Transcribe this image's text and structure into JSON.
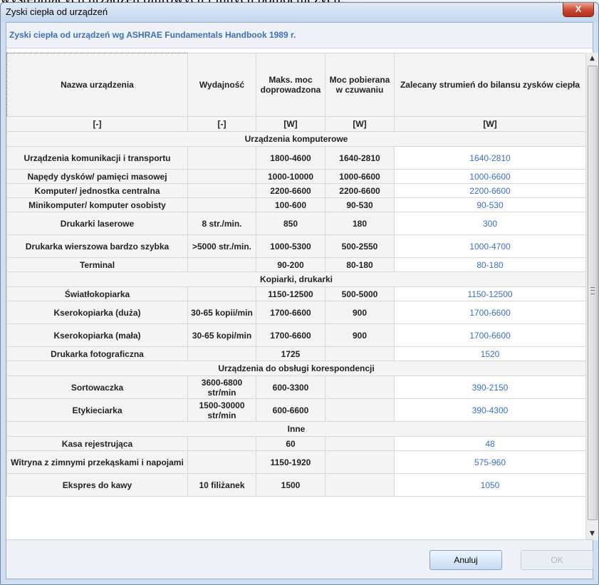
{
  "background_text": "występujących urządzeń biurowych i innych pomocniczych.",
  "window": {
    "title": "Zyski ciepła od urządzeń",
    "close_label": "X"
  },
  "panel_title": "Zyski ciepła od urządzeń wg ASHRAE Fundamentals Handbook 1989 r.",
  "columns": [
    {
      "header": "Nazwa urządzenia",
      "unit": "[-]"
    },
    {
      "header": "Wydajność",
      "unit": "[-]"
    },
    {
      "header": "Maks. moc doprowadzona",
      "unit": "[W]"
    },
    {
      "header": "Moc pobierana w czuwaniu",
      "unit": "[W]"
    },
    {
      "header": "Zalecany strumień do bilansu zysków ciepła",
      "unit": "[W]"
    }
  ],
  "groups": [
    {
      "label": "Urządzenia komputerowe",
      "rows": [
        [
          "Urządzenia komunikacji i transportu",
          "",
          "1800-4600",
          "1640-2810",
          "1640-2810"
        ],
        [
          "Napędy dysków/ pamięci masowej",
          "",
          "1000-10000",
          "1000-6600",
          "1000-6600"
        ],
        [
          "Komputer/ jednostka centralna",
          "",
          "2200-6600",
          "2200-6600",
          "2200-6600"
        ],
        [
          "Minikomputer/ komputer osobisty",
          "",
          "100-600",
          "90-530",
          "90-530"
        ],
        [
          "Drukarki laserowe",
          "8 str./min.",
          "850",
          "180",
          "300"
        ],
        [
          "Drukarka wierszowa bardzo szybka",
          ">5000 str./min.",
          "1000-5300",
          "500-2550",
          "1000-4700"
        ],
        [
          "Terminal",
          "",
          "90-200",
          "80-180",
          "80-180"
        ]
      ]
    },
    {
      "label": "Kopiarki, drukarki",
      "rows": [
        [
          "Światłokopiarka",
          "",
          "1150-12500",
          "500-5000",
          "1150-12500"
        ],
        [
          "Kserokopiarka (duża)",
          "30-65 kopii/min",
          "1700-6600",
          "900",
          "1700-6600"
        ],
        [
          "Kserokopiarka (mała)",
          "30-65 kopi/min",
          "1700-6600",
          "900",
          "1700-6600"
        ],
        [
          "Drukarka fotograficzna",
          "",
          "1725",
          "",
          "1520"
        ]
      ]
    },
    {
      "label": "Urządzenia do obsługi korespondencji",
      "rows": [
        [
          "Sortowaczka",
          "3600-6800 str/min",
          "600-3300",
          "",
          "390-2150"
        ],
        [
          "Etykieciarka",
          "1500-30000 str/min",
          "600-6600",
          "",
          "390-4300"
        ]
      ]
    },
    {
      "label": "Inne",
      "rows": [
        [
          "Kasa rejestrująca",
          "",
          "60",
          "",
          "48"
        ],
        [
          "Witryna z zimnymi przekąskami i napojami",
          "",
          "1150-1920",
          "",
          "575-960"
        ],
        [
          "Ekspres do kawy",
          "10 filiżanek",
          "1500",
          "",
          "1050"
        ]
      ]
    }
  ],
  "buttons": {
    "cancel": "Anuluj",
    "ok": "OK"
  },
  "colors": {
    "recommended_value": "#3b6ec8",
    "panel_title": "#3d6fb7",
    "close_button": "#c8462f"
  }
}
